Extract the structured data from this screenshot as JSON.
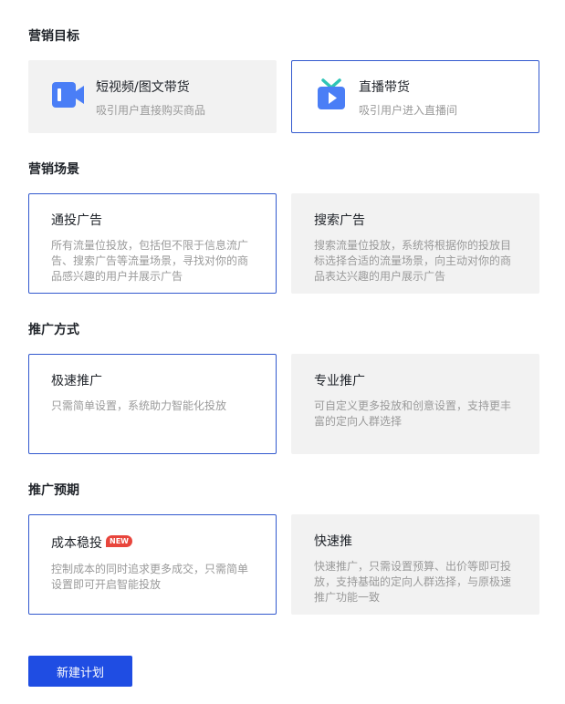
{
  "sections": {
    "goal": {
      "title": "营销目标",
      "options": [
        {
          "title": "短视频/图文带货",
          "desc": "吸引用户直接购买商品",
          "icon": "video-camera-icon"
        },
        {
          "title": "直播带货",
          "desc": "吸引用户进入直播间",
          "icon": "live-tv-icon"
        }
      ]
    },
    "scene": {
      "title": "营销场景",
      "options": [
        {
          "title": "通投广告",
          "desc": "所有流量位投放，包括但不限于信息流广告、搜索广告等流量场景，寻找对你的商品感兴趣的用户并展示广告"
        },
        {
          "title": "搜索广告",
          "desc": "搜索流量位投放，系统将根据你的投放目标选择合适的流量场景，向主动对你的商品表达兴趣的用户展示广告"
        }
      ]
    },
    "method": {
      "title": "推广方式",
      "options": [
        {
          "title": "极速推广",
          "desc": "只需简单设置，系统助力智能化投放"
        },
        {
          "title": "专业推广",
          "desc": "可自定义更多投放和创意设置，支持更丰富的定向人群选择"
        }
      ]
    },
    "expect": {
      "title": "推广预期",
      "options": [
        {
          "title": "成本稳投",
          "badge": "NEW",
          "desc": "控制成本的同时追求更多成交，只需简单设置即可开启智能投放"
        },
        {
          "title": "快速推",
          "desc": "快速推广，只需设置预算、出价等即可投放，支持基础的定向人群选择，与原极速推广功能一致"
        }
      ]
    }
  },
  "colors": {
    "selected_border": "#3259ce",
    "card_bg": "#f2f2f2",
    "primary": "#1f4de3",
    "badge": "#e8453c"
  },
  "create_button": "新建计划"
}
